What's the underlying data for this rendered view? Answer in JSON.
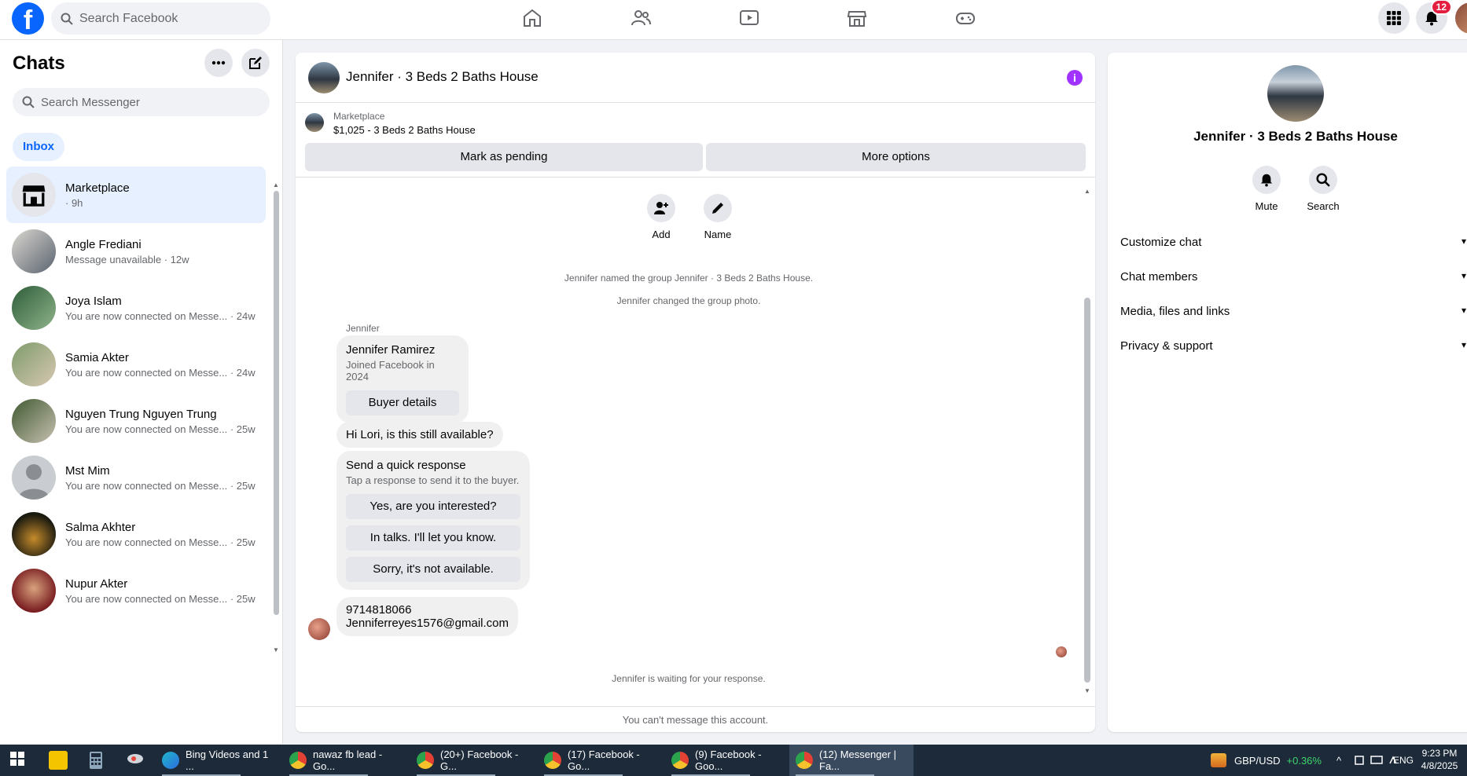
{
  "topnav": {
    "search_placeholder": "Search Facebook",
    "notifications_count": "12"
  },
  "sidebar": {
    "title": "Chats",
    "search_placeholder": "Search Messenger",
    "inbox_label": "Inbox",
    "chats": [
      {
        "name": "Marketplace",
        "sub": "· 9h"
      },
      {
        "name": "Angle Frediani",
        "sub": "Message unavailable · 12w"
      },
      {
        "name": "Joya Islam",
        "sub": "You are now connected on Messe... · 24w"
      },
      {
        "name": "Samia Akter",
        "sub": "You are now connected on Messe... · 24w"
      },
      {
        "name": "Nguyen Trung Nguyen Trung",
        "sub": "You are now connected on Messe... · 25w"
      },
      {
        "name": "Mst Mim",
        "sub": "You are now connected on Messe... · 25w"
      },
      {
        "name": "Salma Akhter",
        "sub": "You are now connected on Messe... · 25w"
      },
      {
        "name": "Nupur Akter",
        "sub": "You are now connected on Messe... · 25w"
      }
    ]
  },
  "conversation": {
    "title": "Jennifer · 3 Beds 2 Baths House",
    "marketplace_label": "Marketplace",
    "listing": "$1,025 - 3 Beds 2 Baths House",
    "mark_pending": "Mark as pending",
    "more_options": "More options",
    "add_label": "Add",
    "name_label": "Name",
    "sys_named": "Jennifer named the group Jennifer · 3 Beds 2 Baths House.",
    "sys_photo": "Jennifer changed the group photo.",
    "sender": "Jennifer",
    "profile_card": {
      "name": "Jennifer Ramirez",
      "joined": "Joined Facebook in 2024",
      "button": "Buyer details"
    },
    "message_1": "Hi Lori, is this still available?",
    "quick_response": {
      "title": "Send a quick response",
      "subtitle": "Tap a response to send it to the buyer.",
      "options": [
        "Yes, are you interested?",
        "In talks. I'll let you know.",
        "Sorry, it's not available."
      ]
    },
    "message_2_line1": "9714818066",
    "message_2_line2": "Jenniferreyes1576@gmail.com",
    "waiting": "Jennifer is waiting for your response.",
    "cant_message": "You can't message this account."
  },
  "details": {
    "title": "Jennifer · 3 Beds 2 Baths House",
    "mute": "Mute",
    "search": "Search",
    "sections": [
      "Customize chat",
      "Chat members",
      "Media, files and links",
      "Privacy & support"
    ]
  },
  "taskbar": {
    "apps": [
      "Bing Videos and 1 ...",
      "nawaz fb lead - Go...",
      "(20+) Facebook - G...",
      "(17) Facebook - Go...",
      "(9) Facebook - Goo...",
      "(12) Messenger | Fa..."
    ],
    "currency": "GBP/USD",
    "currency_change": "+0.36%",
    "lang": "ENG",
    "time": "9:23 PM",
    "date": "4/8/2025"
  }
}
